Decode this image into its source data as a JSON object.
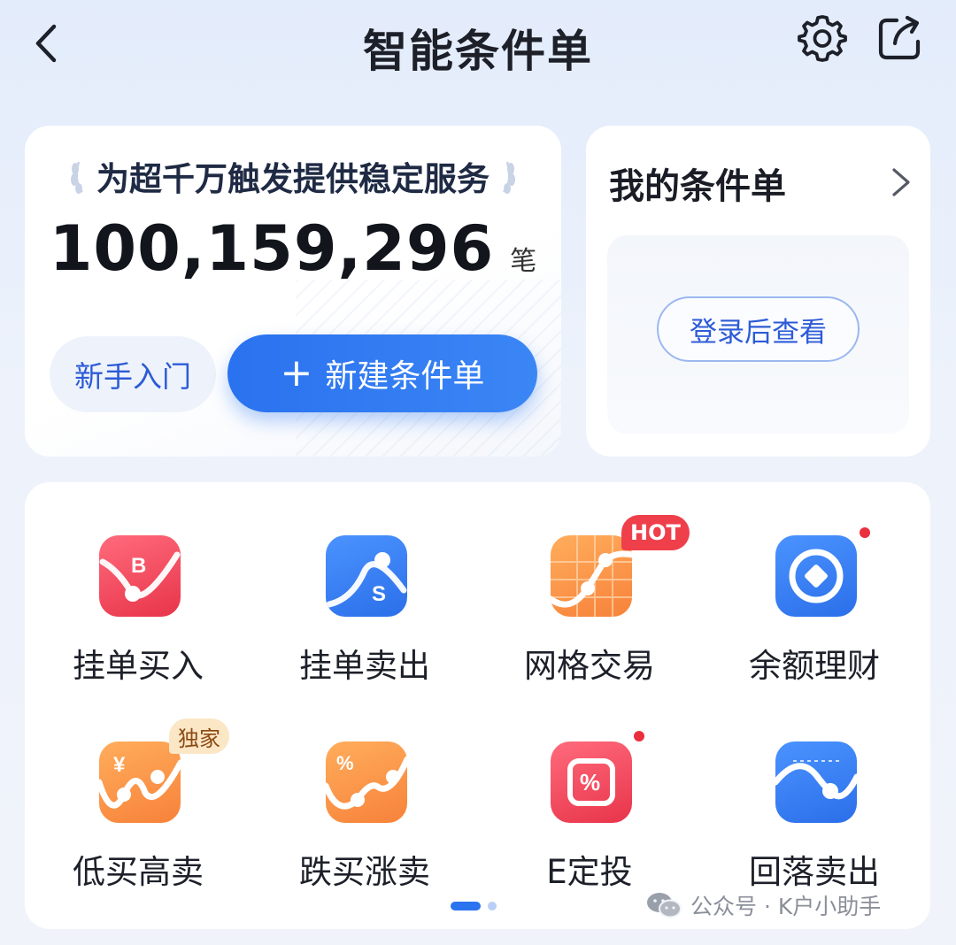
{
  "header": {
    "title": "智能条件单"
  },
  "stats": {
    "slogan": "为超千万触发提供稳定服务",
    "count": "100,159,296",
    "unit": "笔",
    "beginner_label": "新手入门",
    "create_plus": "+",
    "create_label": "新建条件单"
  },
  "my_orders": {
    "title": "我的条件单",
    "login_label": "登录后查看"
  },
  "tools": [
    {
      "label": "挂单买入",
      "icon": "buy-order-icon",
      "icon_letter": "B"
    },
    {
      "label": "挂单卖出",
      "icon": "sell-order-icon",
      "icon_letter": "S"
    },
    {
      "label": "网格交易",
      "icon": "grid-trading-icon",
      "badge": "HOT"
    },
    {
      "label": "余额理财",
      "icon": "balance-finance-icon",
      "dot": true
    },
    {
      "label": "低买高卖",
      "icon": "buy-low-sell-high-icon",
      "icon_letter": "¥",
      "badge": "独家"
    },
    {
      "label": "跌买涨卖",
      "icon": "dip-buy-rise-sell-icon",
      "icon_letter": "%"
    },
    {
      "label": "E定投",
      "icon": "auto-invest-icon",
      "icon_letter": "%",
      "dot": true
    },
    {
      "label": "回落卖出",
      "icon": "pullback-sell-icon"
    }
  ],
  "pager": {
    "pages": 2,
    "current": 1
  },
  "watermark": {
    "text": "公众号 · K户小助手"
  },
  "colors": {
    "accent": "#2b73ef",
    "red_icon": "#f0465a",
    "blue_icon": "#3a7ff2",
    "orange_icon": "#f7923a",
    "hot_badge": "#ef3f4a",
    "exclusive_badge": "#fbe6c6"
  }
}
